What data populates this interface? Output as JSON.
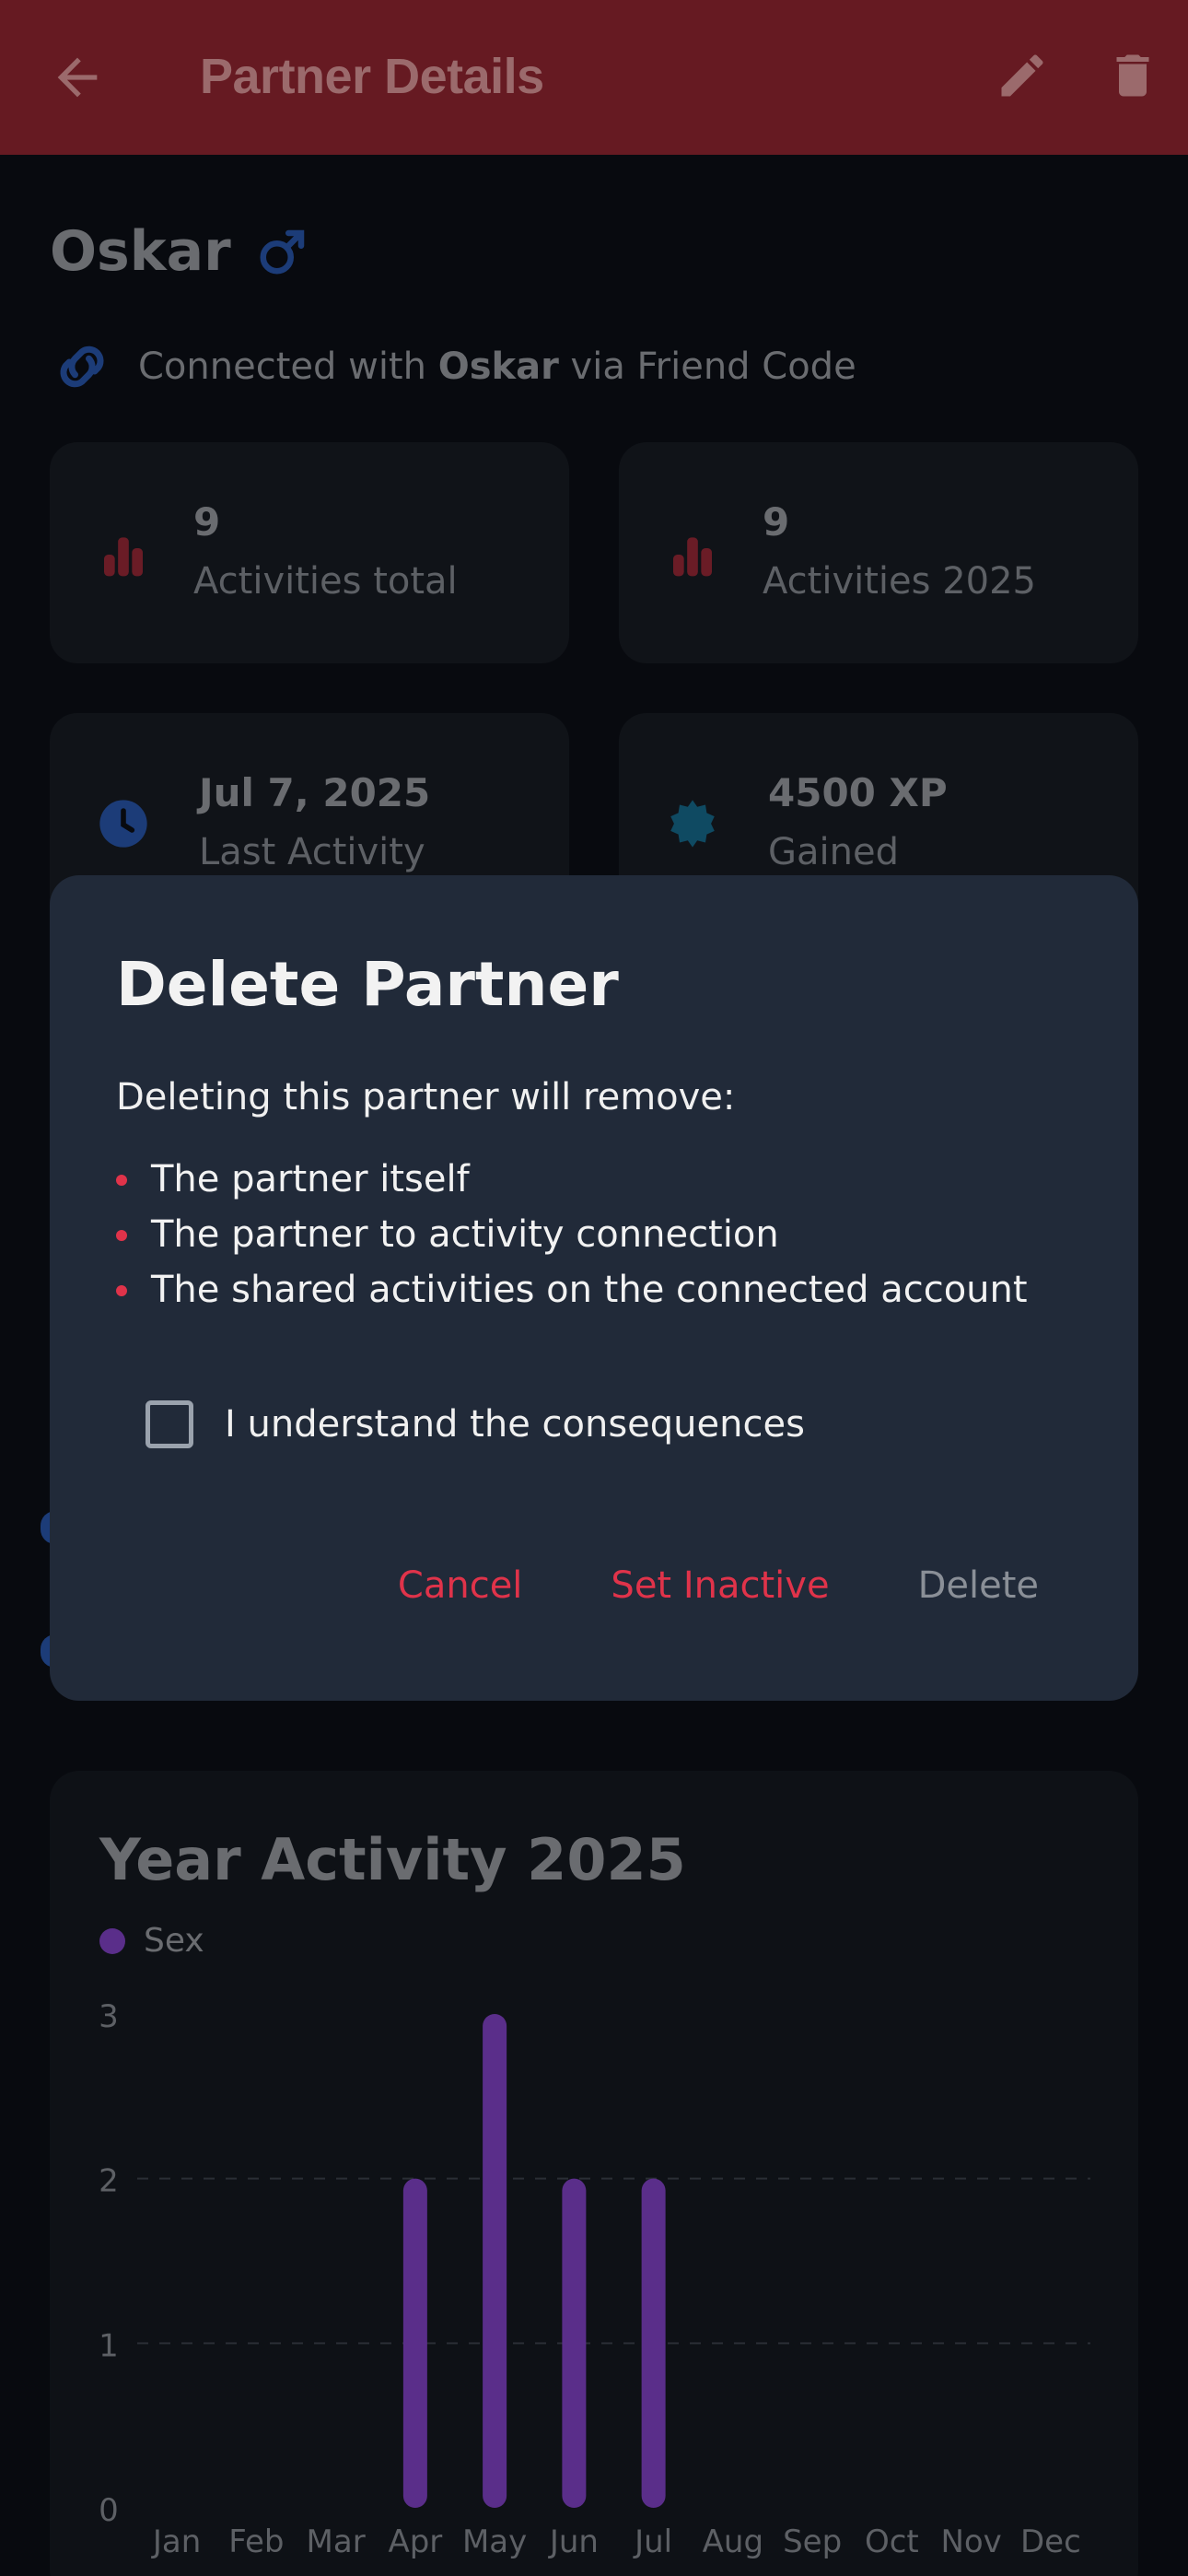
{
  "appbar": {
    "title": "Partner Details",
    "icons": {
      "back": "arrow-left-icon",
      "edit": "pencil-icon",
      "delete": "trash-icon"
    },
    "color": "#661a22"
  },
  "partner": {
    "name": "Oskar",
    "gender_icon": "male-icon",
    "connection": {
      "prefix": "Connected with ",
      "name": "Oskar",
      "suffix": " via Friend Code"
    }
  },
  "stats": [
    {
      "value": "9",
      "label": "Activities total",
      "icon": "bar-chart-icon"
    },
    {
      "value": "9",
      "label": "Activities 2025",
      "icon": "bar-chart-icon"
    },
    {
      "value": "Jul 7, 2025",
      "label": "Last Activity",
      "icon": "clock-icon"
    },
    {
      "value": "4500 XP",
      "label": "Gained",
      "icon": "badge-icon"
    }
  ],
  "dialog": {
    "title": "Delete Partner",
    "intro": "Deleting this partner will remove:",
    "items": [
      "The partner itself",
      "The partner to activity connection",
      "The shared activities on the connected account"
    ],
    "checkbox_label": "I understand the consequences",
    "checkbox_checked": false,
    "buttons": {
      "cancel": "Cancel",
      "set_inactive": "Set Inactive",
      "delete": "Delete"
    },
    "accent": "#e0334a"
  },
  "chart_data": {
    "type": "bar",
    "title": "Year Activity 2025",
    "categories": [
      "Jan",
      "Feb",
      "Mar",
      "Apr",
      "May",
      "Jun",
      "Jul",
      "Aug",
      "Sep",
      "Oct",
      "Nov",
      "Dec"
    ],
    "series": [
      {
        "name": "Sex",
        "values": [
          0,
          0,
          0,
          2,
          3,
          2,
          2,
          0,
          0,
          0,
          0,
          0
        ],
        "color": "#5a2e8a"
      }
    ],
    "ylim": [
      0,
      3
    ],
    "yticks": [
      "0",
      "1",
      "2",
      "3"
    ],
    "grid": true,
    "legend": "top-left"
  }
}
